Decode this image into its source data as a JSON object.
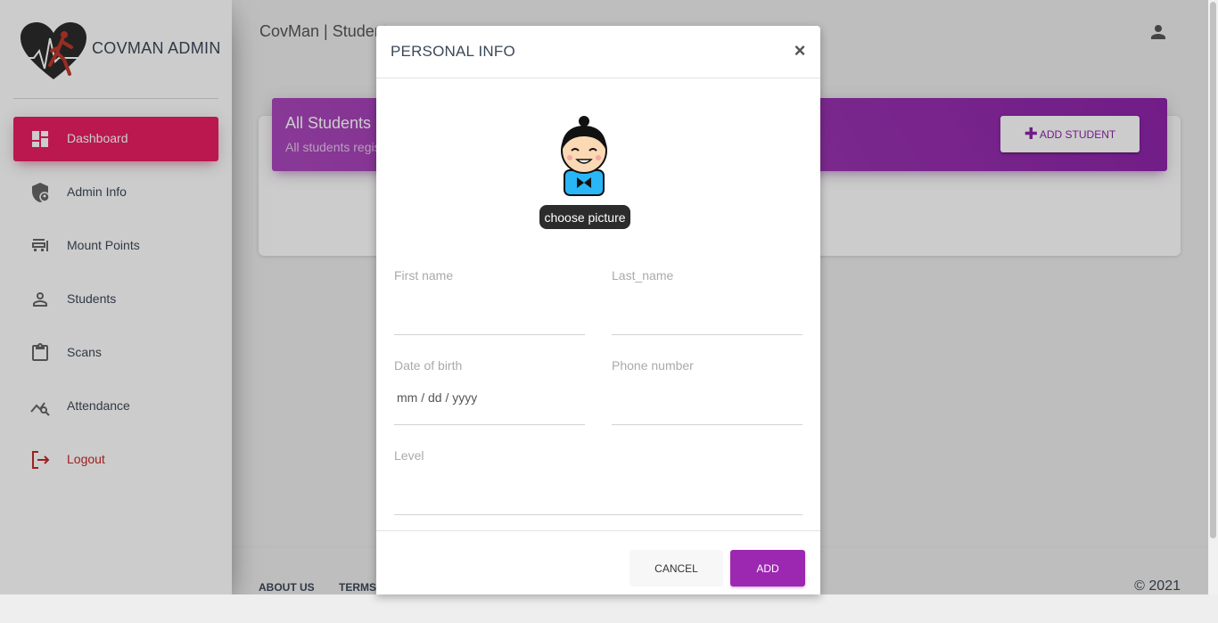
{
  "brand": {
    "name": "COVMAN ADMIN"
  },
  "sidebar": {
    "items": [
      {
        "label": "Dashboard",
        "icon": "dashboard-icon",
        "active": true
      },
      {
        "label": "Admin Info",
        "icon": "admin-shield-icon"
      },
      {
        "label": "Mount Points",
        "icon": "mount-point-icon"
      },
      {
        "label": "Students",
        "icon": "person-icon"
      },
      {
        "label": "Scans",
        "icon": "clipboard-icon"
      },
      {
        "label": "Attendance",
        "icon": "attendance-chart-icon"
      },
      {
        "label": "Logout",
        "icon": "logout-icon"
      }
    ]
  },
  "header": {
    "title": "CovMan | Students",
    "user_icon": "account-icon"
  },
  "card": {
    "title": "All Students",
    "subtitle": "All students registered",
    "add_button": "ADD STUDENT",
    "add_icon": "plus-icon"
  },
  "footer": {
    "links": [
      "ABOUT US",
      "TERMS"
    ],
    "copyright": "© 2021"
  },
  "modal": {
    "title": "PERSONAL INFO",
    "close": "×",
    "choose_picture": "choose picture",
    "fields": {
      "first_name": {
        "label": "First name",
        "value": ""
      },
      "last_name": {
        "label": "Last_name",
        "value": ""
      },
      "dob": {
        "label": "Date of birth",
        "value": "mm / dd / yyyy"
      },
      "phone": {
        "label": "Phone number",
        "value": ""
      },
      "level": {
        "label": "Level",
        "value": ""
      }
    },
    "cancel": "CANCEL",
    "add": "ADD"
  },
  "colors": {
    "active_nav": "#e91e63",
    "primary": "#9c27b0",
    "logout": "#c62828"
  }
}
